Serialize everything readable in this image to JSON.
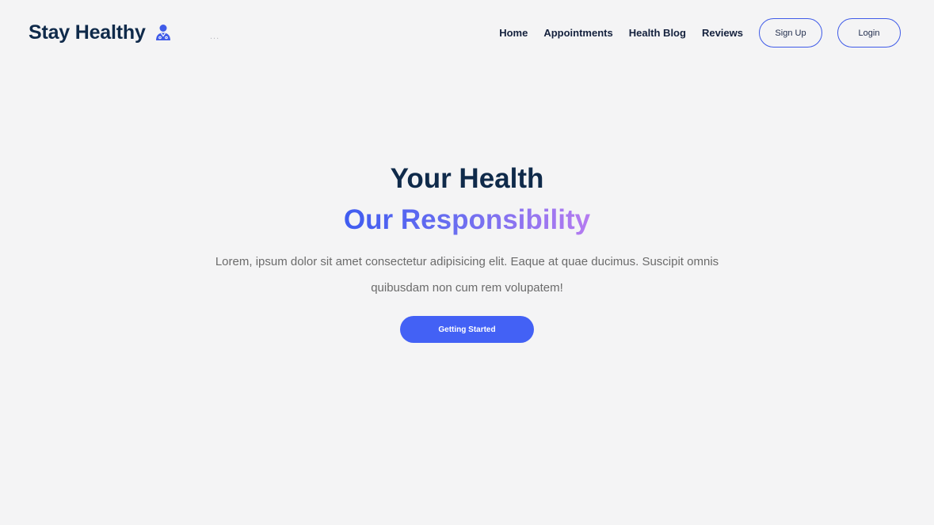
{
  "brand": {
    "name": "Stay Healthy",
    "icon": "doctor-icon",
    "accent_color": "#3f5be8",
    "dots": "..."
  },
  "nav": {
    "links": [
      {
        "label": "Home"
      },
      {
        "label": "Appointments"
      },
      {
        "label": "Health Blog"
      },
      {
        "label": "Reviews"
      }
    ],
    "signup_label": "Sign Up",
    "login_label": "Login"
  },
  "hero": {
    "title": "Your Health",
    "subtitle": "Our Responsibility",
    "subtitle_gradient": [
      "#3f5cf0",
      "#b57bf0"
    ],
    "description": "Lorem, ipsum dolor sit amet consectetur adipisicing elit. Eaque at quae ducimus. Suscipit omnis quibusdam non cum rem volupatem!",
    "cta_label": "Getting Started",
    "cta_color": "#4361f5"
  }
}
